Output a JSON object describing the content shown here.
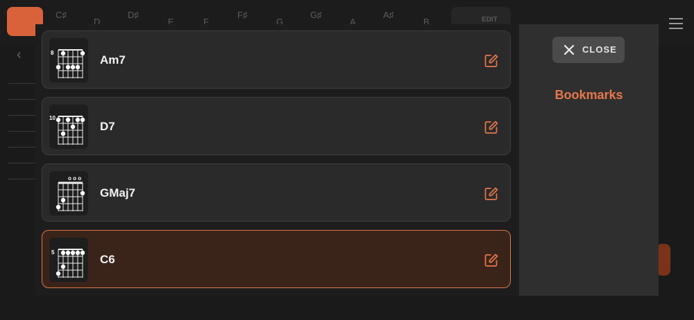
{
  "background": {
    "key_notes": [
      "C♯",
      "D",
      "D♯",
      "E",
      "F",
      "F♯",
      "G",
      "G♯",
      "A",
      "A♯",
      "B"
    ],
    "edit_label": "EDIT"
  },
  "bookmarks": {
    "title": "Bookmarks",
    "close_label": "CLOSE",
    "items": [
      {
        "name": "Am7",
        "fret": "8",
        "active": false
      },
      {
        "name": "D7",
        "fret": "10",
        "active": false
      },
      {
        "name": "GMaj7",
        "fret": "",
        "open_strings": "o o o",
        "active": false
      },
      {
        "name": "C6",
        "fret": "5",
        "active": true
      }
    ]
  },
  "colors": {
    "accent": "#e8774c",
    "active_item_bg": "#3a2419",
    "active_item_border": "#d9764c"
  },
  "icons": {
    "edit": "edit-pencil-icon",
    "close": "close-x-icon",
    "menu": "hamburger-menu-icon",
    "back": "chevron-left-icon"
  }
}
